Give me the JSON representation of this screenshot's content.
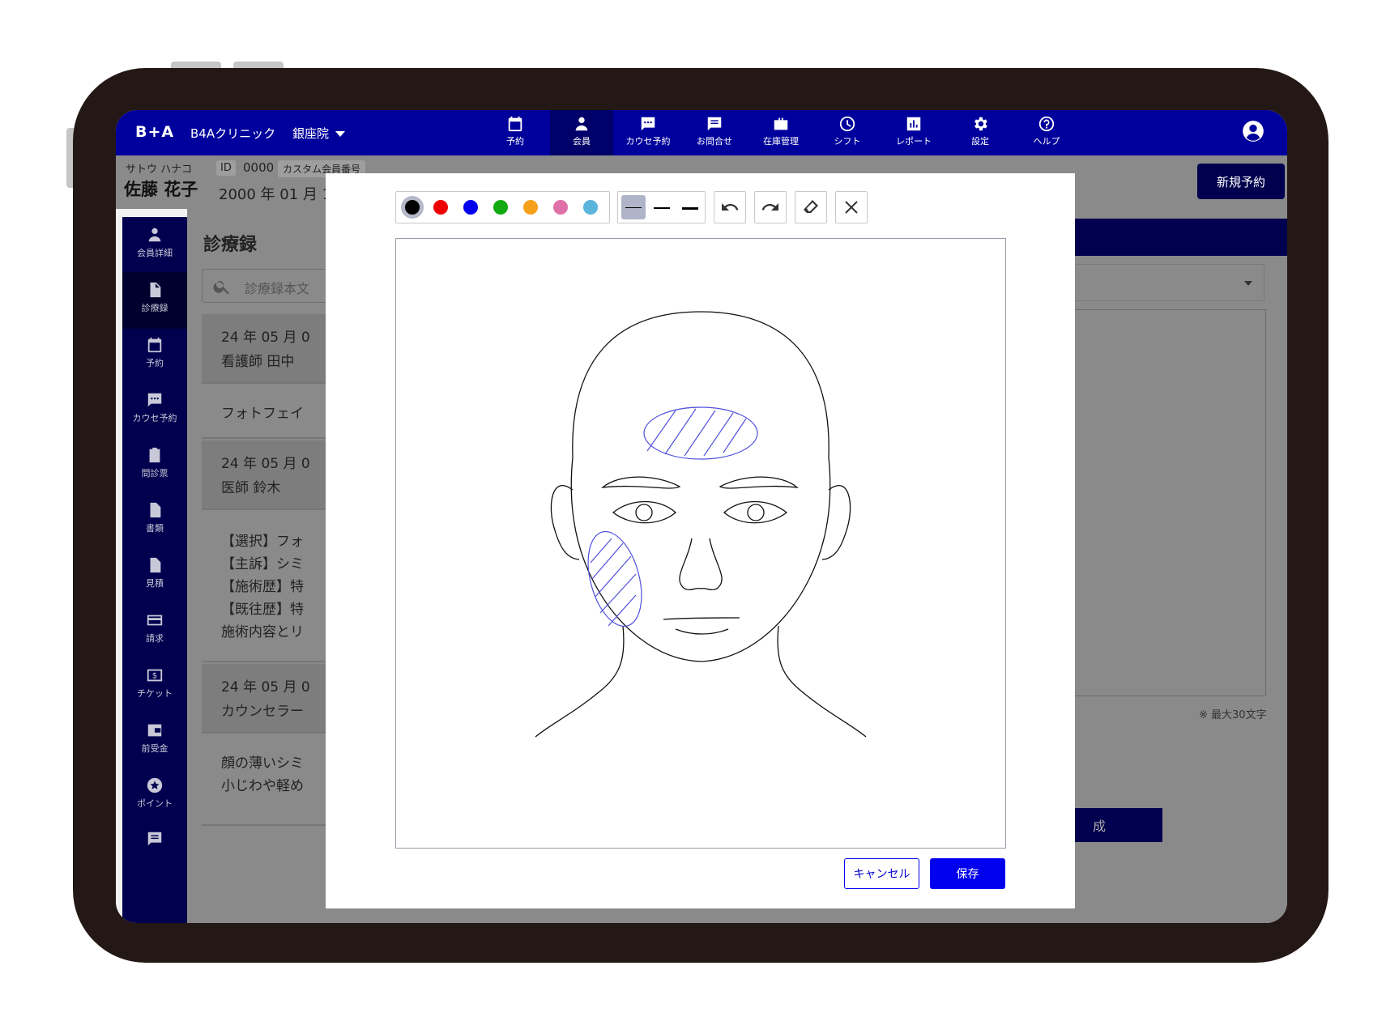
{
  "topnav": {
    "logo": "B+A",
    "clinic": "B4Aクリニック",
    "branch": "銀座院",
    "items": [
      {
        "label": "予約",
        "icon": "calendar-icon"
      },
      {
        "label": "会員",
        "icon": "person-icon"
      },
      {
        "label": "カウセ予約",
        "icon": "chat-bubble-icon"
      },
      {
        "label": "お問合せ",
        "icon": "message-icon"
      },
      {
        "label": "在庫管理",
        "icon": "briefcase-icon"
      },
      {
        "label": "シフト",
        "icon": "clock-icon"
      },
      {
        "label": "レポート",
        "icon": "bar-chart-icon"
      },
      {
        "label": "設定",
        "icon": "gear-icon"
      },
      {
        "label": "ヘルプ",
        "icon": "help-icon"
      }
    ],
    "active": "会員"
  },
  "member": {
    "kana": "サトウ ハナコ",
    "name": "佐藤 花子",
    "id_label": "ID",
    "id_value": "0000",
    "custom_label": "カスタム会員番号",
    "birth": "2000 年 01 月 1"
  },
  "new_reservation_label": "新規予約",
  "sidebar": {
    "items": [
      {
        "label": "会員詳細",
        "icon": "person-icon"
      },
      {
        "label": "診療録",
        "icon": "document-icon"
      },
      {
        "label": "予約",
        "icon": "calendar-icon"
      },
      {
        "label": "カウセ予約",
        "icon": "chat-bubble-icon"
      },
      {
        "label": "問診票",
        "icon": "clipboard-icon"
      },
      {
        "label": "書類",
        "icon": "file-icon"
      },
      {
        "label": "見積",
        "icon": "file-icon"
      },
      {
        "label": "請求",
        "icon": "credit-card-icon"
      },
      {
        "label": "チケット",
        "icon": "ticket-icon"
      },
      {
        "label": "前受金",
        "icon": "wallet-icon"
      },
      {
        "label": "ポイント",
        "icon": "star-icon"
      },
      {
        "label": "",
        "icon": "message-icon"
      }
    ],
    "active": "診療録"
  },
  "records": {
    "title": "診療録",
    "search_placeholder": "診療録本文",
    "cards": [
      {
        "date": "24 年 05 月 0",
        "author": "看護師 田中",
        "body": [
          "フォトフェイ"
        ]
      },
      {
        "date": "24 年 05 月 0",
        "author": "医師 鈴木",
        "body": [
          "【選択】フォ",
          "【主訴】シミ",
          "【施術歴】特",
          "【既往歴】特",
          "施術内容とリ"
        ]
      },
      {
        "date": "24 年 05 月 0",
        "author": "カウンセラー",
        "body": [
          "顔の薄いシミ",
          "小じわや軽め"
        ]
      }
    ]
  },
  "right_panel": {
    "max_chars": "※ 最大30文字",
    "button_label": "成"
  },
  "modal": {
    "colors": [
      "#000000",
      "#ee0000",
      "#0000ee",
      "#11aa11",
      "#f5a01a",
      "#e070a8",
      "#5ab4dc"
    ],
    "selected_color": "#000000",
    "stroke_sizes": [
      "thin",
      "medium",
      "thick"
    ],
    "selected_stroke": "thin",
    "tools": [
      "undo-icon",
      "redo-icon",
      "eraser-icon",
      "clear-icon"
    ],
    "annotation_color": "#5050dd",
    "cancel_label": "キャンセル",
    "save_label": "保存"
  }
}
